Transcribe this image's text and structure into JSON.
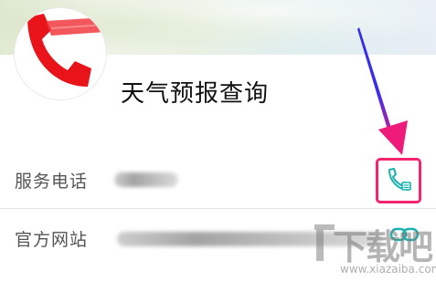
{
  "app": {
    "name": "天气预报查询"
  },
  "rows": [
    {
      "label": "服务电话",
      "action_icon": "phone-icon"
    },
    {
      "label": "官方网站",
      "action_icon": "link-icon"
    }
  ],
  "watermark": {
    "text": "下载吧",
    "url": "www.xiazaiba.com"
  },
  "colors": {
    "highlight": "#f2246e",
    "icon_teal": "#1bb3b0",
    "arrow_blue": "#2f2bf0",
    "arrow_pink": "#ef1b7a"
  }
}
